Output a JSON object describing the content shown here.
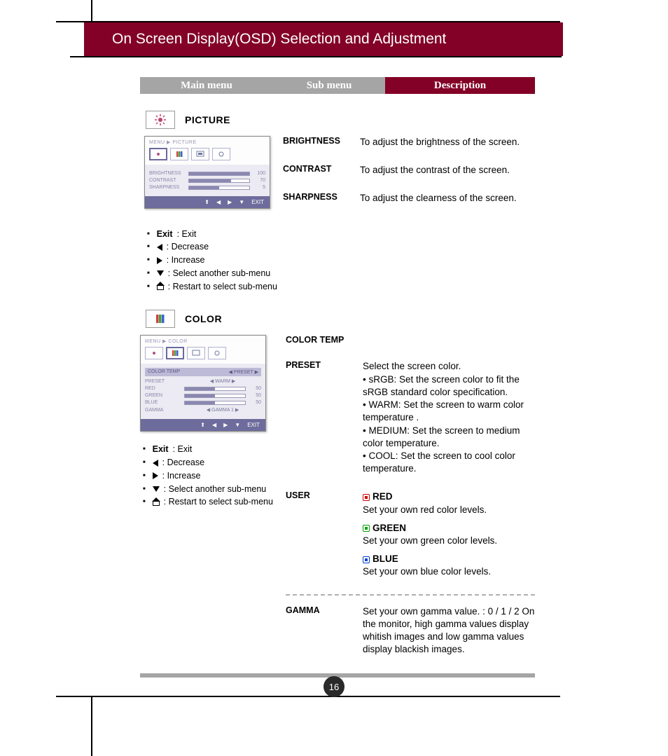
{
  "page": {
    "title": "On Screen Display(OSD) Selection and Adjustment",
    "number": "16"
  },
  "headers": {
    "main": "Main menu",
    "sub": "Sub menu",
    "desc": "Description"
  },
  "picture": {
    "label": "PICTURE",
    "osd": {
      "breadcrumb": "MENU ▶ PICTURE",
      "rows": [
        {
          "name": "BRIGHTNESS",
          "value": "100",
          "fill": 100
        },
        {
          "name": "CONTRAST",
          "value": "70",
          "fill": 70
        },
        {
          "name": "SHARPNESS",
          "value": "5",
          "fill": 50
        }
      ],
      "footer_exit": "EXIT"
    },
    "items": [
      {
        "sub": "BRIGHTNESS",
        "desc": "To adjust the brightness of the screen."
      },
      {
        "sub": "CONTRAST",
        "desc": "To adjust the contrast of the screen."
      },
      {
        "sub": "SHARPNESS",
        "desc": "To adjust the clearness of the screen."
      }
    ]
  },
  "legend": {
    "exit_label": "Exit",
    "exit_desc": ": Exit",
    "decrease": ": Decrease",
    "increase": ": Increase",
    "select": ": Select another sub-menu",
    "restart": ": Restart to select sub-menu"
  },
  "color": {
    "label": "COLOR",
    "osd": {
      "breadcrumb": "MENU ▶ COLOR",
      "subhead_left": "COLOR TEMP",
      "subhead_right": "PRESET",
      "rows": [
        {
          "name": "PRESET",
          "value": "WARM"
        },
        {
          "name": "RED",
          "value": "50",
          "fill": 50
        },
        {
          "name": "GREEN",
          "value": "50",
          "fill": 50
        },
        {
          "name": "BLUE",
          "value": "50",
          "fill": 50
        },
        {
          "name": "GAMMA",
          "value": "GAMMA 1"
        }
      ],
      "footer_exit": "EXIT"
    },
    "colortemp_label": "COLOR TEMP",
    "preset": {
      "sub": "PRESET",
      "intro": "Select the screen color.",
      "srgb": "• sRGB: Set the screen color to fit the sRGB standard color specification.",
      "warm": "• WARM: Set the screen to warm color temperature .",
      "medium": "• MEDIUM: Set the screen to medium color temperature.",
      "cool": "• COOL: Set the screen to cool color temperature."
    },
    "user": {
      "sub": "USER",
      "red_label": "RED",
      "red_desc": "Set your own red color levels.",
      "green_label": "GREEN",
      "green_desc": "Set your own green color levels.",
      "blue_label": "BLUE",
      "blue_desc": "Set your own blue color levels."
    },
    "gamma": {
      "sub": "GAMMA",
      "desc": "Set your own gamma value. : 0 / 1 / 2 On the monitor, high gamma values display whitish images and low gamma values display blackish images."
    }
  }
}
